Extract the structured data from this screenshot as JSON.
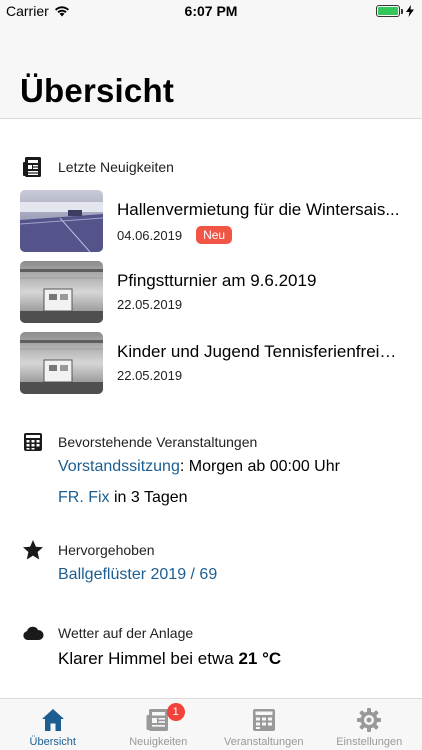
{
  "status_bar": {
    "carrier": "Carrier",
    "time": "6:07 PM"
  },
  "header": {
    "title": "Übersicht"
  },
  "news": {
    "heading": "Letzte Neuigkeiten",
    "items": [
      {
        "title": "Hallenvermietung für die Wintersais...",
        "date": "04.06.2019",
        "badge": "Neu"
      },
      {
        "title": "Pfingstturnier am 9.6.2019",
        "date": "22.05.2019"
      },
      {
        "title": "Kinder und Jugend Tennisferienfreiz...",
        "date": "22.05.2019"
      }
    ]
  },
  "events": {
    "heading": "Bevorstehende Veranstaltungen",
    "items": [
      {
        "name": "Vorstandssitzung",
        "separator": ":",
        "when": " Morgen ab 00:00 Uhr"
      },
      {
        "name": "FR. Fix",
        "when": " in 3 Tagen"
      }
    ]
  },
  "featured": {
    "heading": "Hervorgehoben",
    "link": "Ballgeflüster 2019 / 69"
  },
  "weather": {
    "heading": "Wetter auf der Anlage",
    "text": "Klarer Himmel bei etwa",
    "temperature": "21 °C"
  },
  "tabs": [
    {
      "label": "Übersicht",
      "icon": "home-icon",
      "active": true
    },
    {
      "label": "Neuigkeiten",
      "icon": "newspaper-icon",
      "badge": "1"
    },
    {
      "label": "Veranstaltungen",
      "icon": "calendar-icon"
    },
    {
      "label": "Einstellungen",
      "icon": "gear-icon"
    }
  ],
  "colors": {
    "accent": "#1c5e91",
    "badge": "#f05545",
    "bar_background": "#f7f7f7"
  }
}
